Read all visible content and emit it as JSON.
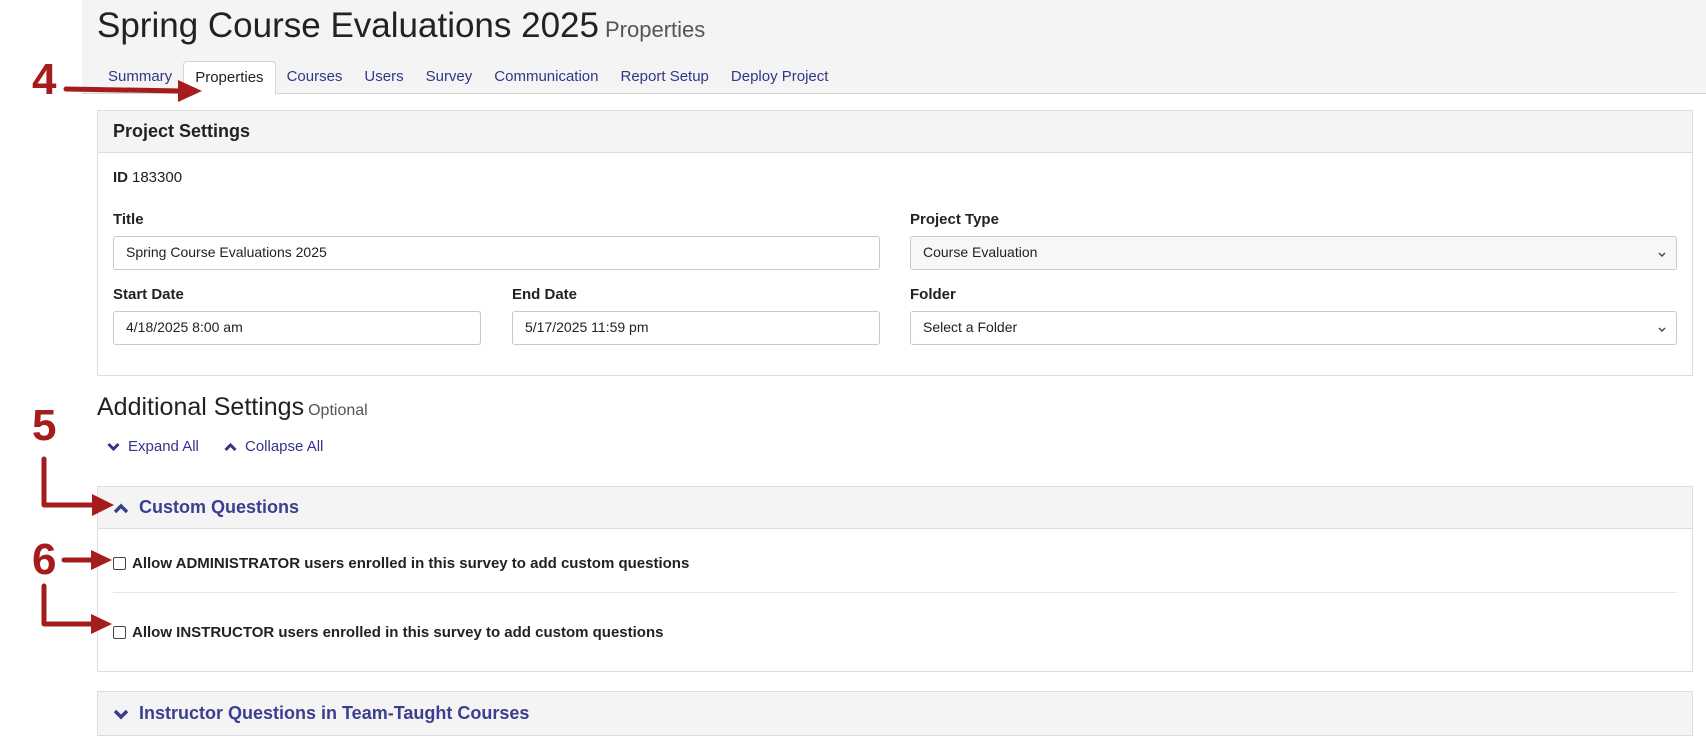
{
  "header": {
    "title": "Spring Course Evaluations 2025",
    "subtitle": "Properties",
    "tabs": [
      {
        "label": "Summary",
        "active": false
      },
      {
        "label": "Properties",
        "active": true
      },
      {
        "label": "Courses",
        "active": false
      },
      {
        "label": "Users",
        "active": false
      },
      {
        "label": "Survey",
        "active": false
      },
      {
        "label": "Communication",
        "active": false
      },
      {
        "label": "Report Setup",
        "active": false
      },
      {
        "label": "Deploy Project",
        "active": false
      }
    ]
  },
  "project_settings": {
    "heading": "Project Settings",
    "id_label": "ID",
    "id_value": "183300",
    "title_label": "Title",
    "title_value": "Spring Course Evaluations 2025",
    "project_type_label": "Project Type",
    "project_type_value": "Course Evaluation",
    "start_date_label": "Start Date",
    "start_date_value": "4/18/2025 8:00 am",
    "end_date_label": "End Date",
    "end_date_value": "5/17/2025 11:59 pm",
    "folder_label": "Folder",
    "folder_value": "Select a Folder"
  },
  "additional_settings": {
    "title": "Additional Settings",
    "optional_label": "Optional",
    "expand_all": "Expand All",
    "collapse_all": "Collapse All",
    "custom_questions": {
      "heading": "Custom Questions",
      "expanded": true,
      "options": [
        {
          "label": "Allow ADMINISTRATOR users enrolled in this survey to add custom questions",
          "checked": false
        },
        {
          "label": "Allow INSTRUCTOR users enrolled in this survey to add custom questions",
          "checked": false
        }
      ]
    },
    "instructor_questions": {
      "heading": "Instructor Questions in Team-Taught Courses",
      "expanded": false
    }
  },
  "annotations": {
    "step4": "4",
    "step5": "5",
    "step6": "6"
  },
  "colors": {
    "link": "#33358a",
    "panel_heading": "#3a3f8f",
    "annotation": "#a51c1c",
    "header_band": "#f4f4f4"
  },
  "icons": {
    "expand_all": "chevron-down-icon",
    "collapse_all": "chevron-up-icon",
    "custom_questions": "chevron-up-icon",
    "instructor_questions": "chevron-down-icon",
    "select_caret": "chevron-down-icon"
  }
}
